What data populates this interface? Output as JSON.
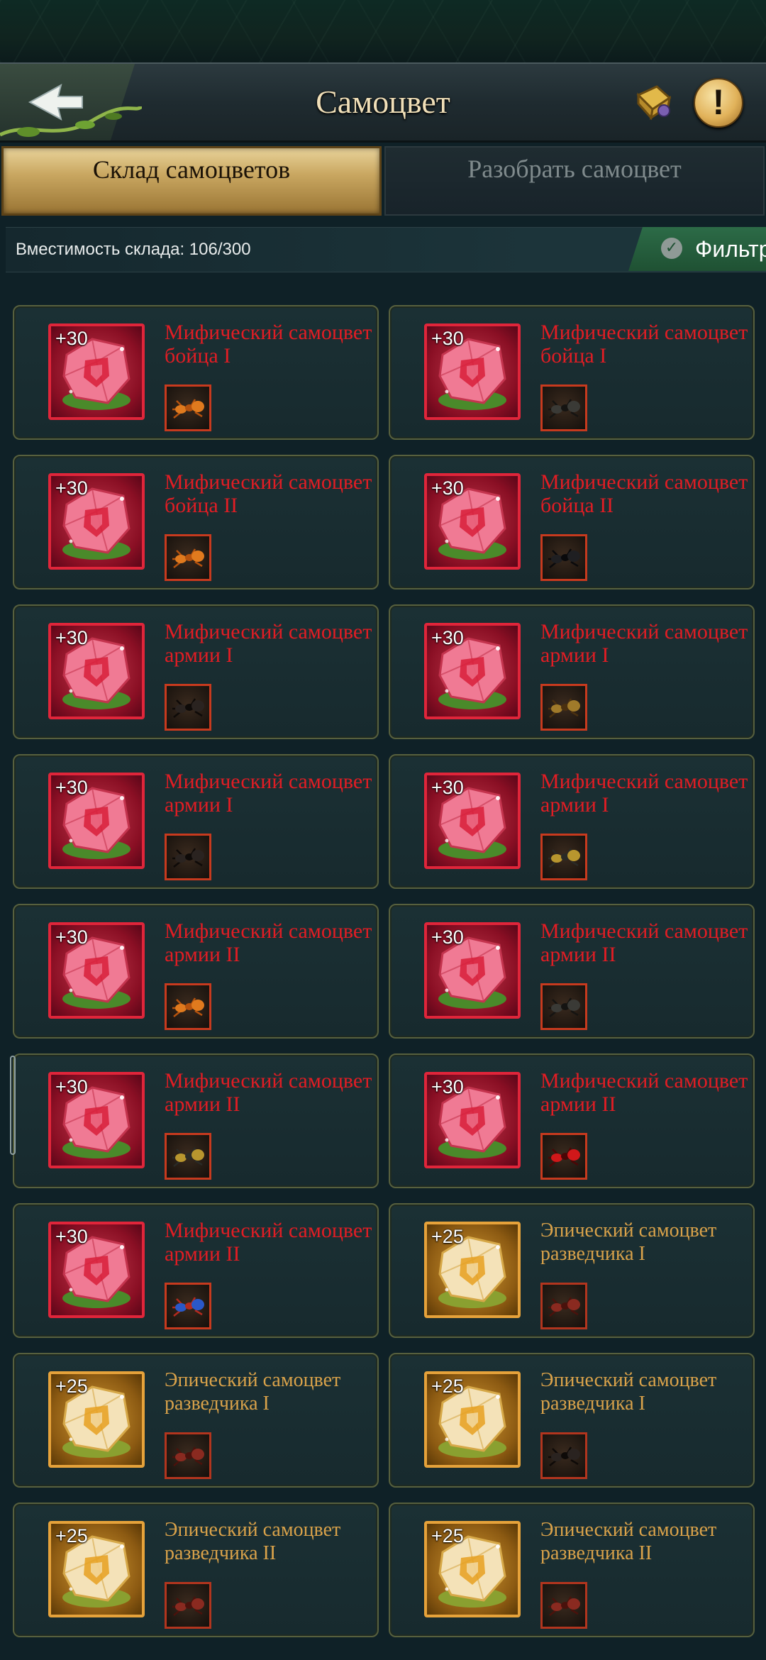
{
  "header": {
    "title": "Самоцвет"
  },
  "tabs": [
    {
      "label": "Склад самоцветов",
      "active": true
    },
    {
      "label": "Разобрать самоцвет",
      "active": false
    }
  ],
  "storage": {
    "capacity_text": "Вместимость склада: 106/300",
    "filter_label": "Фильтр"
  },
  "colors": {
    "mythic": "#e11d24",
    "epic": "#d9a24a",
    "gold_tab": "#c9a761"
  },
  "gems": [
    {
      "level": "+30",
      "name": "Мифический самоцвет бойца I",
      "rarity": "mythic",
      "troop_icon": "orange-ant-icon"
    },
    {
      "level": "+30",
      "name": "Мифический самоцвет бойца I",
      "rarity": "mythic",
      "troop_icon": "beetle-icon"
    },
    {
      "level": "+30",
      "name": "Мифический самоцвет бойца II",
      "rarity": "mythic",
      "troop_icon": "orange-ant-icon"
    },
    {
      "level": "+30",
      "name": "Мифический самоцвет бойца II",
      "rarity": "mythic",
      "troop_icon": "stag-beetle-icon"
    },
    {
      "level": "+30",
      "name": "Мифический самоцвет армии I",
      "rarity": "mythic",
      "troop_icon": "black-ant-icon"
    },
    {
      "level": "+30",
      "name": "Мифический самоцвет армии I",
      "rarity": "mythic",
      "troop_icon": "spider-icon"
    },
    {
      "level": "+30",
      "name": "Мифический самоцвет армии I",
      "rarity": "mythic",
      "troop_icon": "black-ant-icon"
    },
    {
      "level": "+30",
      "name": "Мифический самоцвет армии I",
      "rarity": "mythic",
      "troop_icon": "mantis-icon"
    },
    {
      "level": "+30",
      "name": "Мифический самоцвет армии II",
      "rarity": "mythic",
      "troop_icon": "orange-ant-icon"
    },
    {
      "level": "+30",
      "name": "Мифический самоцвет армии II",
      "rarity": "mythic",
      "troop_icon": "beetle-icon"
    },
    {
      "level": "+30",
      "name": "Мифический самоцвет армии II",
      "rarity": "mythic",
      "troop_icon": "mantis-icon"
    },
    {
      "level": "+30",
      "name": "Мифический самоцвет армии II",
      "rarity": "mythic",
      "troop_icon": "red-beetle-icon"
    },
    {
      "level": "+30",
      "name": "Мифический самоцвет армии II",
      "rarity": "mythic",
      "troop_icon": "blue-ant-icon"
    },
    {
      "level": "+25",
      "name": "Эпический самоцвет разведчика I",
      "rarity": "epic",
      "troop_icon": "red-ant-icon"
    },
    {
      "level": "+25",
      "name": "Эпический самоцвет разведчика I",
      "rarity": "epic",
      "troop_icon": "red-ant-icon"
    },
    {
      "level": "+25",
      "name": "Эпический самоцвет разведчика I",
      "rarity": "epic",
      "troop_icon": "black-ant-icon"
    },
    {
      "level": "+25",
      "name": "Эпический самоцвет разведчика II",
      "rarity": "epic",
      "troop_icon": "red-ant-icon"
    },
    {
      "level": "+25",
      "name": "Эпический самоцвет разведчика II",
      "rarity": "epic",
      "troop_icon": "red-ant-icon"
    }
  ]
}
